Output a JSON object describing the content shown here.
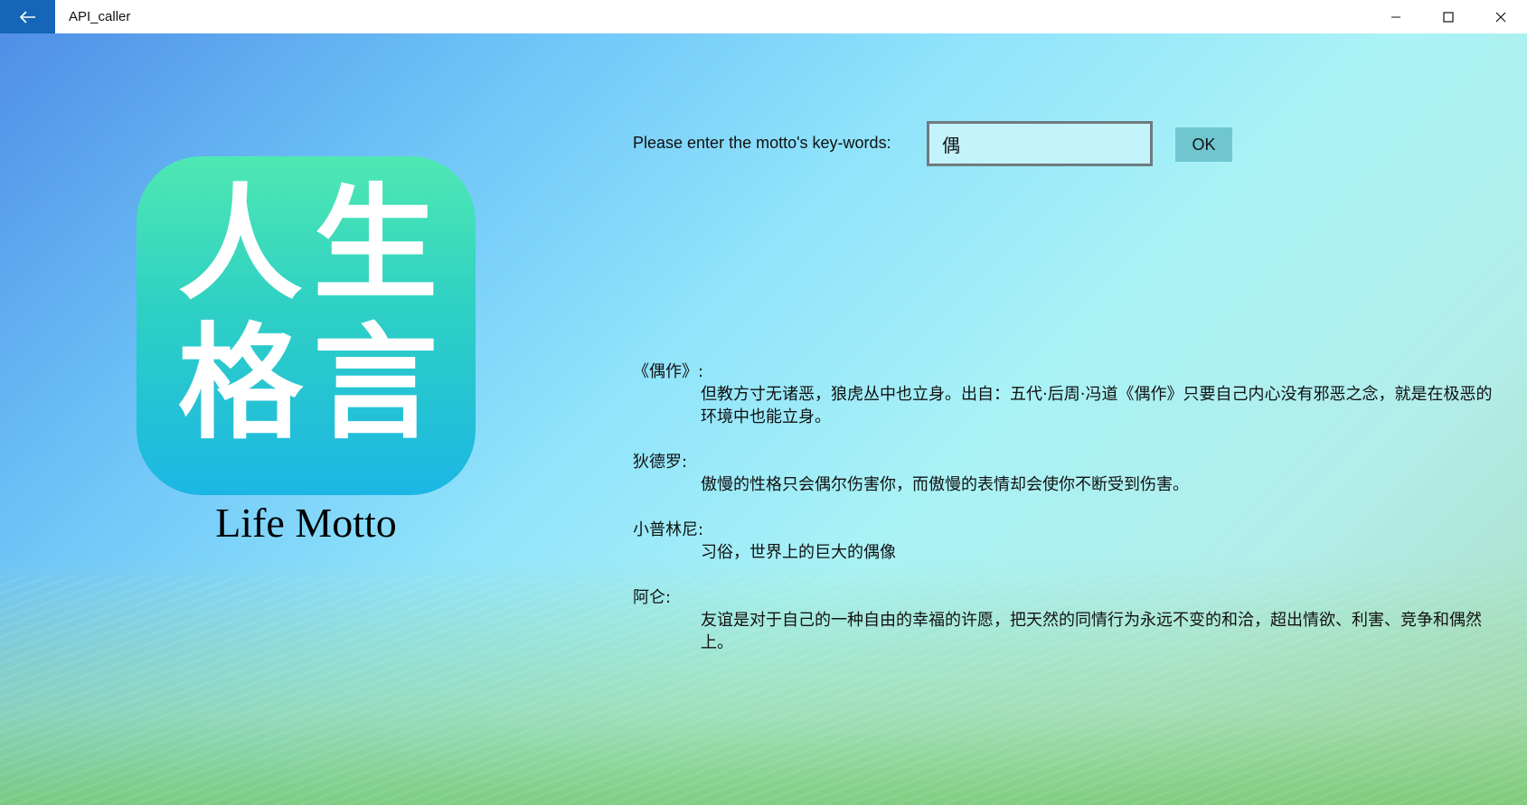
{
  "window": {
    "title": "API_caller",
    "back_icon": "arrow-left-icon",
    "controls": [
      "minimize-icon",
      "maximize-icon",
      "close-icon"
    ],
    "accent_color": "#1565b8"
  },
  "logo": {
    "chars": [
      "人",
      "生",
      "格",
      "言"
    ],
    "caption": "Life Motto"
  },
  "search": {
    "prompt": "Please enter the motto's key-words:",
    "value": "偶",
    "ok_label": "OK"
  },
  "results": [
    {
      "author": "《偶作》:",
      "text": "但教方寸无诸恶，狼虎丛中也立身。出自：五代·后周·冯道《偶作》只要自己内心没有邪恶之念，就是在极恶的环境中也能立身。"
    },
    {
      "author": "狄德罗:",
      "text": "傲慢的性格只会偶尔伤害你，而傲慢的表情却会使你不断受到伤害。"
    },
    {
      "author": "小普林尼:",
      "text": "习俗，世界上的巨大的偶像"
    },
    {
      "author": "阿仑:",
      "text": "友谊是对于自己的一种自由的幸福的许愿，把天然的同情行为永远不变的和洽，超出情欲、利害、竞争和偶然上。"
    }
  ]
}
